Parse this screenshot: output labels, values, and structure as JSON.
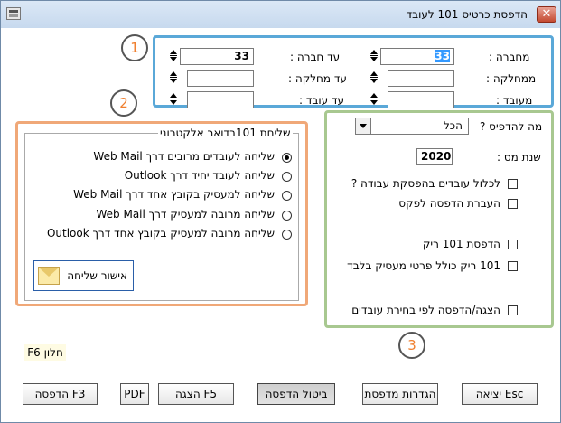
{
  "window": {
    "title": "הדפסת כרטיס 101 לעובד",
    "close_glyph": "✕"
  },
  "range": {
    "from_company_label": "מחברה :",
    "to_company_label": "עד חברה :",
    "from_dept_label": "ממחלקה :",
    "to_dept_label": "עד מחלקה :",
    "from_emp_label": "מעובד :",
    "to_emp_label": "עד עובד :",
    "from_company_value": "33",
    "to_company_value": "33",
    "from_dept_value": "",
    "to_dept_value": "",
    "from_emp_value": "",
    "to_emp_value": ""
  },
  "email_group": {
    "title": "שליחת 101בדואר אלקטרוני",
    "options": [
      {
        "label": "שליחה לעובדים מרובים דרך Web Mail",
        "selected": true
      },
      {
        "label": "שליחה לעובד יחיד דרך Outlook",
        "selected": false
      },
      {
        "label": "שליחה למעסיק בקובץ אחד דרך Web Mail",
        "selected": false
      },
      {
        "label": "שליחה מרובה למעסיק דרך Web Mail",
        "selected": false
      },
      {
        "label": "שליחה מרובה למעסיק בקובץ אחד דרך Outlook",
        "selected": false
      }
    ],
    "confirm_label": "אישור שליחה"
  },
  "print_options": {
    "what_to_print_label": "מה להדפיס ?",
    "what_to_print_value": "הכל",
    "tax_year_label": "שנת מס :",
    "tax_year_value": "2020",
    "checks": [
      {
        "label": "לכלול עובדים בהפסקת עבודה ?",
        "checked": false
      },
      {
        "label": "העברת הדפסה לפקס",
        "checked": false
      },
      {
        "label": "הדפסת 101 ריק",
        "checked": false
      },
      {
        "label": "101 ריק כולל פרטי מעסיק בלבד",
        "checked": false
      },
      {
        "label": "הצגה/הדפסה לפי בחירת עובדים",
        "checked": false
      }
    ]
  },
  "badges": [
    "1",
    "2",
    "3"
  ],
  "footer_note": "F6 חלון",
  "buttons": {
    "print": "הדפסה F3",
    "pdf": "PDF",
    "display": "הצגה F5",
    "cancel_print": "ביטול הדפסה",
    "printer_settings": "הגדרות מדפסת",
    "exit": "יציאה Esc"
  },
  "colors": {
    "badge1": "#5aa8d8",
    "badge2": "#f0a878",
    "badge3": "#a8c890",
    "title_bg": "#c7d9ee"
  }
}
